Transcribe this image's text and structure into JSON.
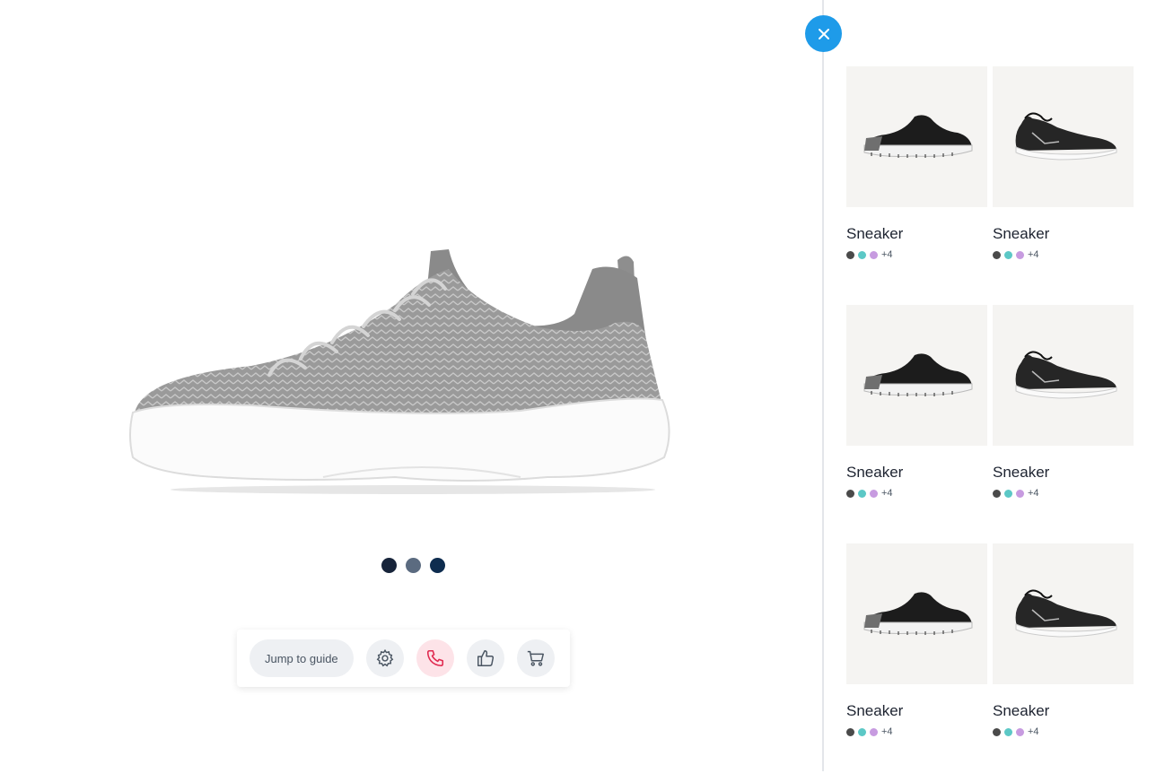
{
  "hero": {
    "image": "grey-knit-sneaker",
    "color_dots": [
      "#17243a",
      "#5b6b80",
      "#0e2c4f"
    ]
  },
  "toolbar": {
    "guide_label": "Jump to guide",
    "icons": [
      "gear-icon",
      "phone-icon",
      "thumbs-up-icon",
      "cart-icon"
    ]
  },
  "panel": {
    "close_icon": "close-icon",
    "accent": "#1e9be9",
    "products": [
      {
        "name": "Sneaker",
        "more": "+4",
        "swatches": [
          "#4a4a4a",
          "#5cc8c6",
          "#c79be0"
        ],
        "style": "a"
      },
      {
        "name": "Sneaker",
        "more": "+4",
        "swatches": [
          "#4a4a4a",
          "#5cc8c6",
          "#c79be0"
        ],
        "style": "b"
      },
      {
        "name": "Sneaker",
        "more": "+4",
        "swatches": [
          "#4a4a4a",
          "#5cc8c6",
          "#c79be0"
        ],
        "style": "a"
      },
      {
        "name": "Sneaker",
        "more": "+4",
        "swatches": [
          "#4a4a4a",
          "#5cc8c6",
          "#c79be0"
        ],
        "style": "b"
      },
      {
        "name": "Sneaker",
        "more": "+4",
        "swatches": [
          "#4a4a4a",
          "#5cc8c6",
          "#c79be0"
        ],
        "style": "a"
      },
      {
        "name": "Sneaker",
        "more": "+4",
        "swatches": [
          "#4a4a4a",
          "#5cc8c6",
          "#c79be0"
        ],
        "style": "b"
      }
    ]
  }
}
